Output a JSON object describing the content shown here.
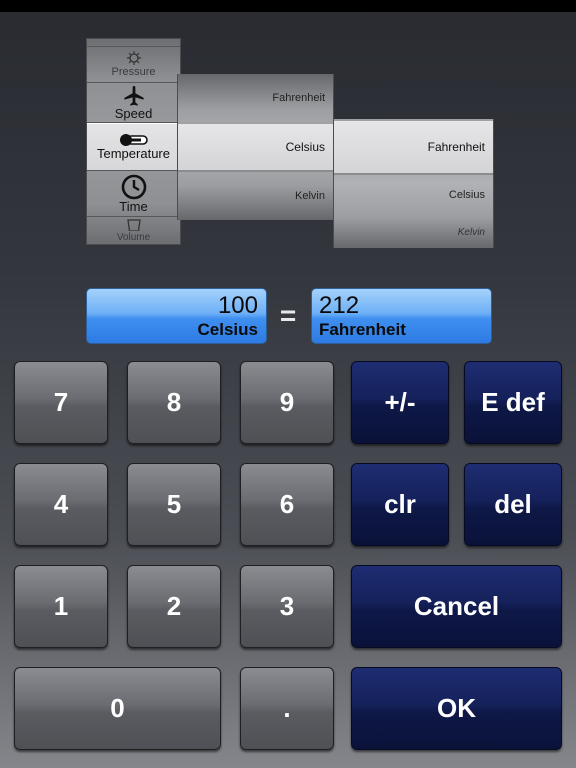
{
  "categories": [
    {
      "label": "",
      "icon": "partial-icon"
    },
    {
      "label": "Pressure",
      "icon": "pressure-icon"
    },
    {
      "label": "Speed",
      "icon": "airplane-icon"
    },
    {
      "label": "Temperature",
      "icon": "thermometer-icon"
    },
    {
      "label": "Time",
      "icon": "clock-icon"
    },
    {
      "label": "Volume",
      "icon": "cup-icon"
    }
  ],
  "from_wheel": {
    "above": "Fahrenheit",
    "selected": "Celsius",
    "below": "Kelvin"
  },
  "to_wheel": {
    "selected": "Fahrenheit",
    "below": "Celsius",
    "below2": "Kelvin"
  },
  "display": {
    "from_value": "100",
    "from_unit": "Celsius",
    "equals": "=",
    "to_value": "212",
    "to_unit": "Fahrenheit"
  },
  "keys": {
    "k7": "7",
    "k8": "8",
    "k9": "9",
    "sign": "+/-",
    "edef": "E def",
    "k4": "4",
    "k5": "5",
    "k6": "6",
    "clr": "clr",
    "del": "del",
    "k1": "1",
    "k2": "2",
    "k3": "3",
    "cancel": "Cancel",
    "k0": "0",
    "dot": ".",
    "ok": "OK"
  }
}
